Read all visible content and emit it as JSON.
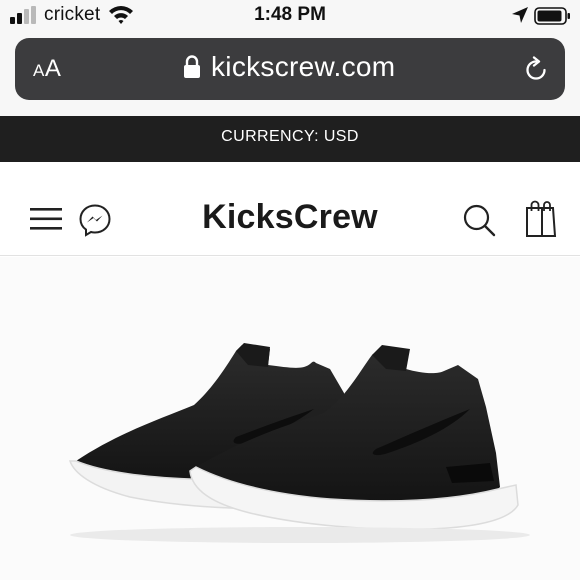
{
  "status_bar": {
    "carrier": "cricket",
    "time": "1:48 PM",
    "signal_icon": "cell-signal-icon",
    "wifi_icon": "wifi-icon",
    "location_icon": "location-arrow-icon",
    "battery_icon": "battery-icon"
  },
  "browser": {
    "text_size_label_small": "A",
    "text_size_label_large": "A",
    "url": "kickscrew.com",
    "lock_icon": "lock-icon",
    "reload_icon": "reload-icon",
    "bar_color": "#3c3c3e"
  },
  "banner": {
    "currency_text": "CURRENCY: USD",
    "background": "#1f1f1f"
  },
  "header": {
    "brand": "KicksCrew",
    "menu_icon": "hamburger-menu-icon",
    "messenger_icon": "messenger-icon",
    "search_icon": "search-icon",
    "bag_icon": "shopping-bag-icon"
  },
  "product": {
    "image": "black-knit-slip-on-running-shoes"
  }
}
